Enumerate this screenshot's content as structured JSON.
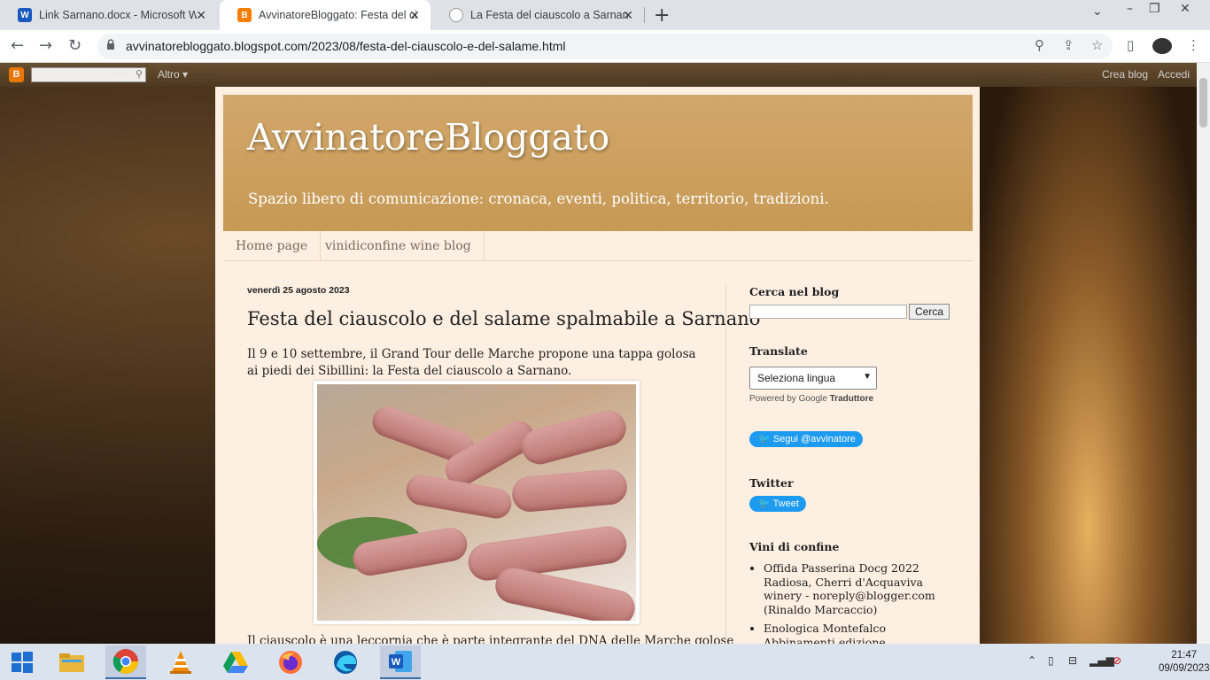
{
  "browser": {
    "tabs": [
      {
        "title": "Link Sarnano.docx - Microsoft Word",
        "icon": "word-icon"
      },
      {
        "title": "AvvinatoreBloggato: Festa del ciauscolo",
        "icon": "blogger-icon"
      },
      {
        "title": "La Festa del ciauscolo a Sarnano",
        "icon": "page-icon"
      }
    ],
    "url": "avvinatorebloggato.blogspot.com/2023/08/festa-del-ciauscolo-e-del-salame.html"
  },
  "navbar": {
    "altro": "Altro ▾",
    "crea": "Crea blog",
    "accedi": "Accedi"
  },
  "blog": {
    "title": "AvvinatoreBloggato",
    "description": "Spazio libero di comunicazione: cronaca, eventi, politica, territorio, tradizioni.",
    "tabs": [
      "Home page",
      "vinidiconfine wine blog"
    ]
  },
  "post": {
    "date": "venerdì 25 agosto 2023",
    "title": "Festa del ciauscolo e del salame spalmabile a Sarnano",
    "intro": "Il 9 e 10 settembre, il Grand Tour delle Marche propone una tappa golosa ai piedi dei Sibillini: la Festa del ciauscolo a Sarnano.",
    "next": "Il ciauscolo è una leccornia che è parte integrante del DNA delle Marche golose"
  },
  "sidebar": {
    "search_title": "Cerca nel blog",
    "search_button": "Cerca",
    "translate_title": "Translate",
    "translate_select": "Seleziona lingua",
    "powered": "Powered by",
    "google": "Google",
    "translator": "Traduttore",
    "follow_button": "Segui @avvinatore",
    "twitter_title": "Twitter",
    "tweet_button": "Tweet",
    "vini_title": "Vini di confine",
    "vini_items": [
      "Offida Passerina Docg 2022 Radiosa, Cherri d'Acquaviva winery - noreply@blogger.com (Rinaldo Marcaccio)",
      "Enologica Montefalco Abbinamenti edizione"
    ]
  },
  "taskbar": {
    "time": "21:47",
    "date": "09/09/2023"
  }
}
